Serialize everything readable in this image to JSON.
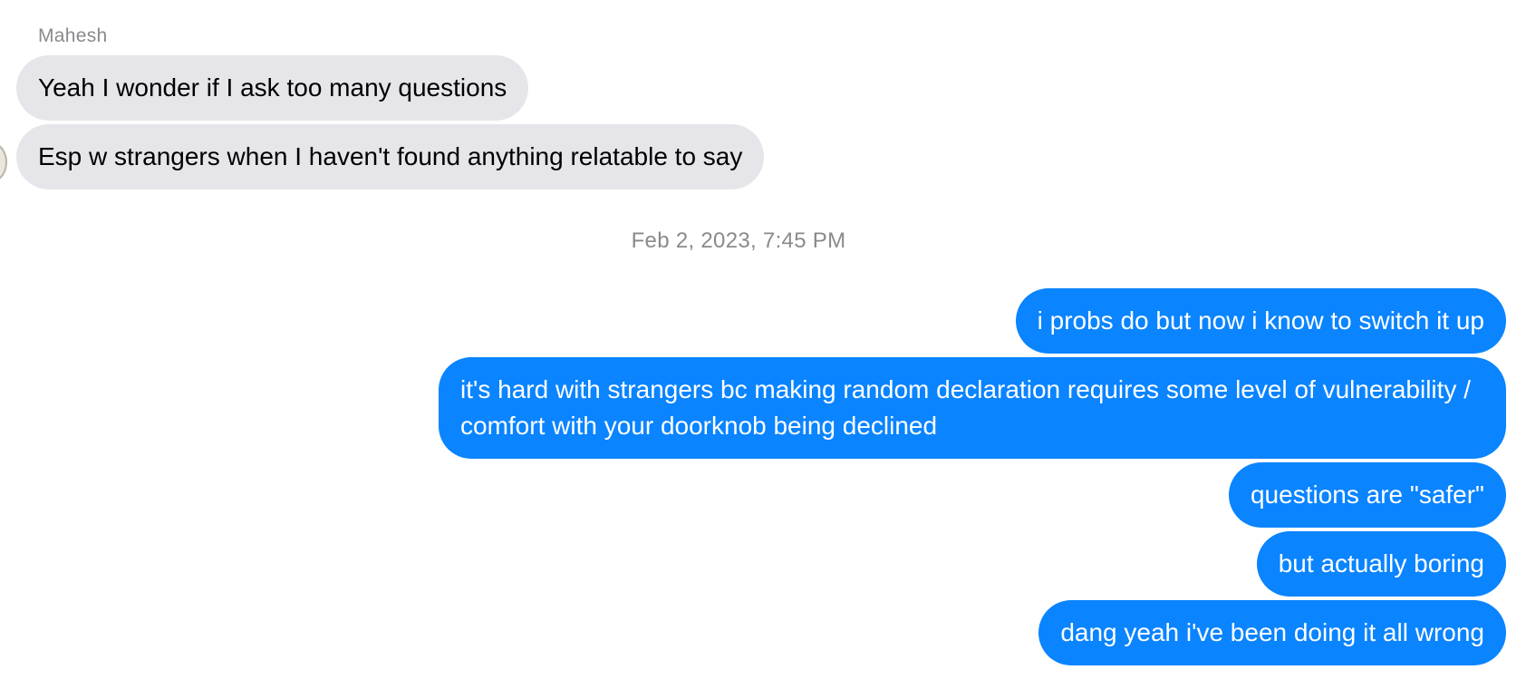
{
  "conversation": {
    "sender_name": "Mahesh",
    "received_messages": [
      "Yeah I wonder if I ask too many questions",
      "Esp w strangers when I haven't found anything relatable to say"
    ],
    "timestamp": "Feb 2, 2023, 7:45 PM",
    "sent_messages": [
      "i probs do but now i know to switch it up",
      "it's hard with strangers bc making random declaration requires some level of vulnerability / comfort with your doorknob being declined",
      "questions are \"safer\"",
      "but actually boring",
      "dang yeah i've been doing it all wrong"
    ],
    "colors": {
      "sent_bubble": "#0a84ff",
      "received_bubble": "#e5e5ea",
      "meta_text": "#8a8a8e"
    }
  }
}
